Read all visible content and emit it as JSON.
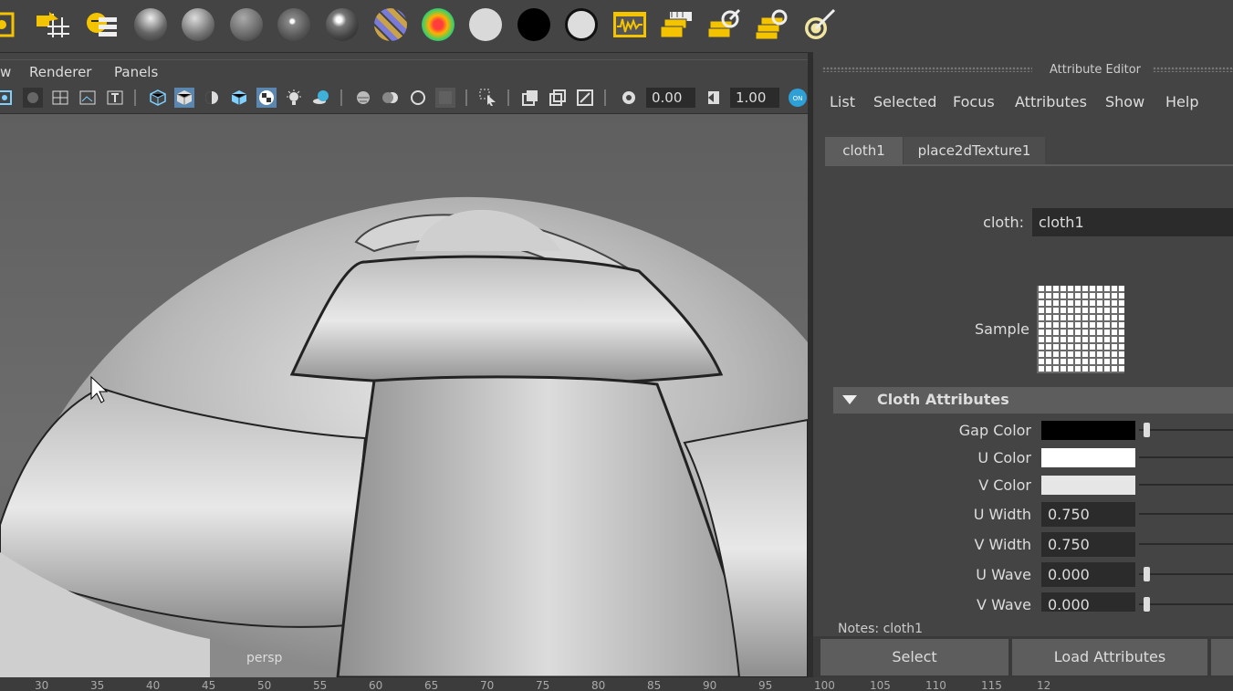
{
  "shelf": {
    "icons": [
      "select-tool-icon",
      "move-snap-icon",
      "hypershade-icon",
      "half-sphere-icon",
      "sphere-icon",
      "sphere-gray-icon",
      "sphere-point-icon",
      "sphere-shiny-icon",
      "striped-sphere-icon",
      "ramp-sphere-icon",
      "white-sphere-icon",
      "black-sphere-icon",
      "white-outlined-sphere-icon",
      "waveform-icon",
      "layers-icon",
      "layers-brush-icon",
      "layers-stack-icon",
      "render-target-icon"
    ]
  },
  "viewport": {
    "menus": [
      "w",
      "Renderer",
      "Panels"
    ],
    "field_a": "0.00",
    "field_b": "1.00",
    "camera_label": "persp"
  },
  "timeline": {
    "ticks": [
      "30",
      "35",
      "40",
      "45",
      "50",
      "55",
      "60",
      "65",
      "70",
      "75",
      "80",
      "85",
      "90",
      "95",
      "100",
      "105",
      "110",
      "115",
      "12"
    ]
  },
  "attribute_editor": {
    "title": "Attribute Editor",
    "menus": [
      "List",
      "Selected",
      "Focus",
      "Attributes",
      "Show",
      "Help"
    ],
    "tabs": [
      "cloth1",
      "place2dTexture1"
    ],
    "node_label": "cloth:",
    "node_value": "cloth1",
    "sample_label": "Sample",
    "section_title": "Cloth Attributes",
    "attrs": [
      {
        "label": "Gap Color",
        "color": "#000000"
      },
      {
        "label": "U Color",
        "color": "#ffffff"
      },
      {
        "label": "V Color",
        "color": "#e6e6e6"
      },
      {
        "label": "U Width",
        "value": "0.750"
      },
      {
        "label": "V Width",
        "value": "0.750"
      },
      {
        "label": "U Wave",
        "value": "0.000"
      },
      {
        "label": "V Wave",
        "value": "0.000"
      }
    ],
    "notes": "Notes:  cloth1",
    "buttons": [
      "Select",
      "Load Attributes"
    ]
  }
}
